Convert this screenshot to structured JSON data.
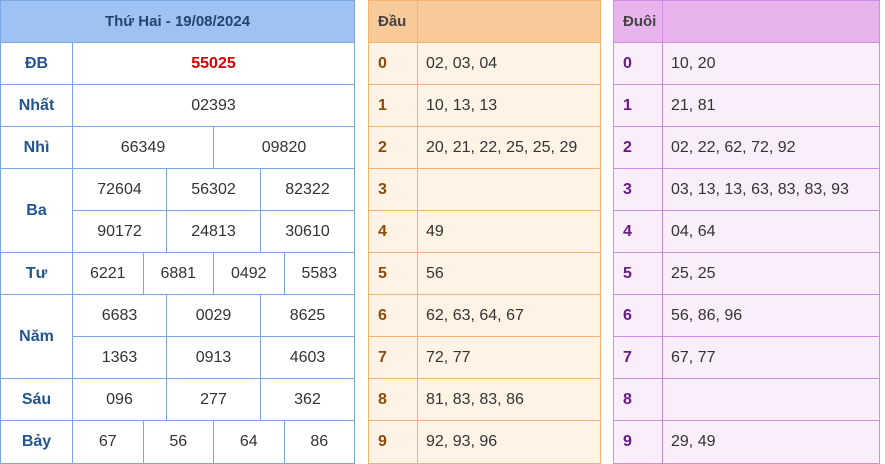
{
  "results": {
    "title": "Thứ Hai - 19/08/2024",
    "prizes": [
      {
        "label": "ĐB",
        "lines": [
          [
            "55025"
          ]
        ],
        "special": true
      },
      {
        "label": "Nhất",
        "lines": [
          [
            "02393"
          ]
        ]
      },
      {
        "label": "Nhì",
        "lines": [
          [
            "66349",
            "09820"
          ]
        ]
      },
      {
        "label": "Ba",
        "lines": [
          [
            "72604",
            "56302",
            "82322"
          ],
          [
            "90172",
            "24813",
            "30610"
          ]
        ]
      },
      {
        "label": "Tư",
        "lines": [
          [
            "6221",
            "6881",
            "0492",
            "5583"
          ]
        ]
      },
      {
        "label": "Năm",
        "lines": [
          [
            "6683",
            "0029",
            "8625"
          ],
          [
            "1363",
            "0913",
            "4603"
          ]
        ]
      },
      {
        "label": "Sáu",
        "lines": [
          [
            "096",
            "277",
            "362"
          ]
        ]
      },
      {
        "label": "Bảy",
        "lines": [
          [
            "67",
            "56",
            "64",
            "86"
          ]
        ]
      }
    ]
  },
  "dau": {
    "header": "Đầu",
    "rows": [
      {
        "digit": "0",
        "values": "02, 03, 04"
      },
      {
        "digit": "1",
        "values": "10, 13, 13"
      },
      {
        "digit": "2",
        "values": "20, 21, 22, 25, 25, 29"
      },
      {
        "digit": "3",
        "values": ""
      },
      {
        "digit": "4",
        "values": "49"
      },
      {
        "digit": "5",
        "values": "56"
      },
      {
        "digit": "6",
        "values": "62, 63, 64, 67"
      },
      {
        "digit": "7",
        "values": "72, 77"
      },
      {
        "digit": "8",
        "values": "81, 83, 83, 86"
      },
      {
        "digit": "9",
        "values": "92, 93, 96"
      }
    ]
  },
  "duoi": {
    "header": "Đuôi",
    "rows": [
      {
        "digit": "0",
        "values": "10, 20"
      },
      {
        "digit": "1",
        "values": "21, 81"
      },
      {
        "digit": "2",
        "values": "02, 22, 62, 72, 92"
      },
      {
        "digit": "3",
        "values": "03, 13, 13, 63, 83, 83, 93"
      },
      {
        "digit": "4",
        "values": "04, 64"
      },
      {
        "digit": "5",
        "values": "25, 25"
      },
      {
        "digit": "6",
        "values": "56, 86, 96"
      },
      {
        "digit": "7",
        "values": "67, 77"
      },
      {
        "digit": "8",
        "values": ""
      },
      {
        "digit": "9",
        "values": "29, 49"
      }
    ]
  },
  "colors": {
    "special_prize": "#e00000",
    "results_header": "#9ec3f3",
    "dau_header": "#f9ca99",
    "duoi_header": "#e9b3ee"
  }
}
